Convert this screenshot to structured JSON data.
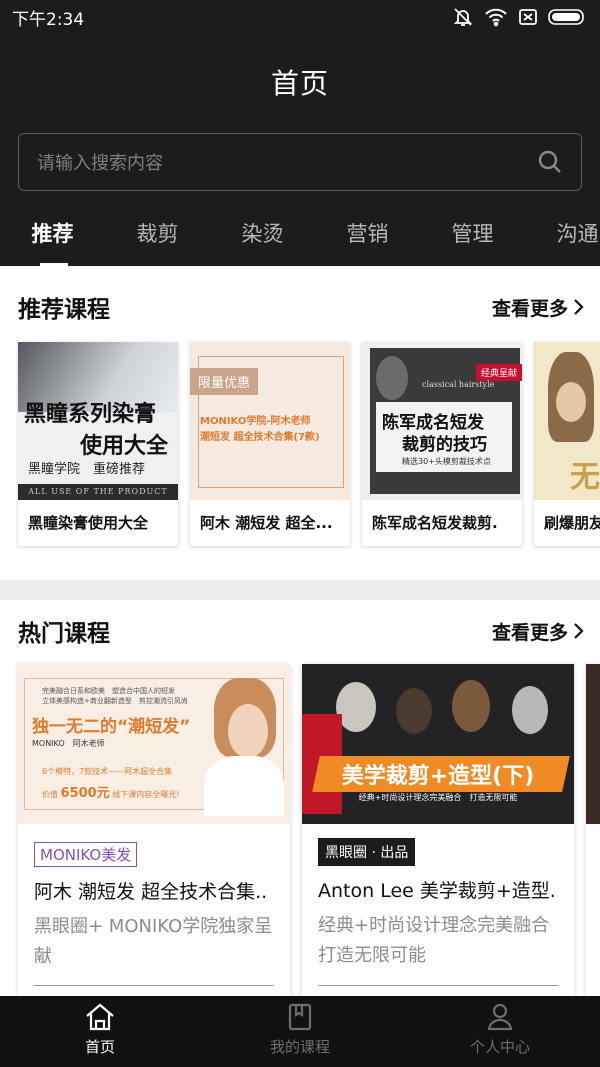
{
  "status": {
    "time": "下午2:34"
  },
  "header": {
    "title": "首页"
  },
  "search": {
    "placeholder": "请输入搜索内容"
  },
  "tabs": [
    {
      "label": "推荐",
      "active": true
    },
    {
      "label": "裁剪"
    },
    {
      "label": "染烫"
    },
    {
      "label": "营销"
    },
    {
      "label": "管理"
    },
    {
      "label": "沟通"
    }
  ],
  "recommended": {
    "title": "推荐课程",
    "more": "查看更多",
    "items": [
      {
        "name": "黑瞳染膏使用大全",
        "thumb": {
          "line1": "黑瞳系列染膏",
          "line2": "使用大全",
          "line3": "黑瞳学院　重磅推荐",
          "line4": "ALL USE OF THE PRODUCT"
        }
      },
      {
        "name": "阿木 潮短发 超全...",
        "thumb": {
          "badge": "限量优惠",
          "line1": "MONIKO学院-阿木老师",
          "line2": "潮短发 超全技术合集(7款)"
        }
      },
      {
        "name": "陈军成名短发裁剪.",
        "thumb": {
          "badge": "经典呈献",
          "line0": "classical hairstyle",
          "line1": "陈军成名短发",
          "line2": "裁剪的技巧",
          "line3": "精选30+头模剪裁技术点"
        }
      },
      {
        "name": "刷爆朋友",
        "thumb": {
          "line1": "无"
        }
      }
    ]
  },
  "hot": {
    "title": "热门课程",
    "more": "查看更多",
    "items": [
      {
        "tag": "MONIKO美发",
        "title": "阿木 潮短发 超全技术合集..",
        "subtitle": "黑眼圈+ MONIKO学院独家呈献",
        "thumb": {
          "top1": "完美融合日系和欧美　塑造合中国人的短发",
          "top2": "立体美感构造+商业翻新造型　剪控潮流引风尚",
          "headline": "独一无二的“潮短发”",
          "byline": "MONIKO　阿木老师",
          "b1": "6个模特，7款技术——阿木超全合集",
          "b2pre": "价值",
          "b2price": "6500元",
          "b2post": "线下课内容全曝光!"
        }
      },
      {
        "tag": "黑眼圈 · 出品",
        "title": "Anton Lee 美学裁剪+造型..",
        "subtitle": "经典+时尚设计理念完美融合 打造无限可能",
        "thumb": {
          "headline": "美学裁剪+造型(下)",
          "sub": "经典+时尚设计理念完美融合　打造无限可能"
        }
      }
    ]
  },
  "nav": [
    {
      "label": "首页",
      "icon": "home-icon",
      "active": true
    },
    {
      "label": "我的课程",
      "icon": "book-icon"
    },
    {
      "label": "个人中心",
      "icon": "person-icon"
    }
  ],
  "colors": {
    "header_bg": "#1c1c1e",
    "tag_purple": "#8a4fb6",
    "accent_orange": "#f08a24"
  }
}
